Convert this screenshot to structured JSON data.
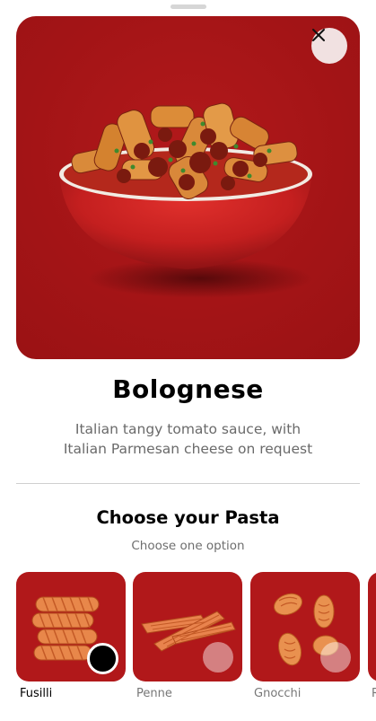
{
  "dish": {
    "title": "Bolognese",
    "description_line1": "Italian tangy tomato sauce, with",
    "description_line2": "Italian Parmesan cheese on request",
    "image": "bolognese-pasta-bowl",
    "accent": "#a31416"
  },
  "close": {
    "icon": "close-icon"
  },
  "pasta": {
    "heading": "Choose your Pasta",
    "subheading": "Choose one option",
    "selected": "Fusilli",
    "options": [
      {
        "label": "Fusilli",
        "selected": true
      },
      {
        "label": "Penne",
        "selected": false
      },
      {
        "label": "Gnocchi",
        "selected": false
      },
      {
        "label": "R",
        "selected": false
      }
    ]
  }
}
